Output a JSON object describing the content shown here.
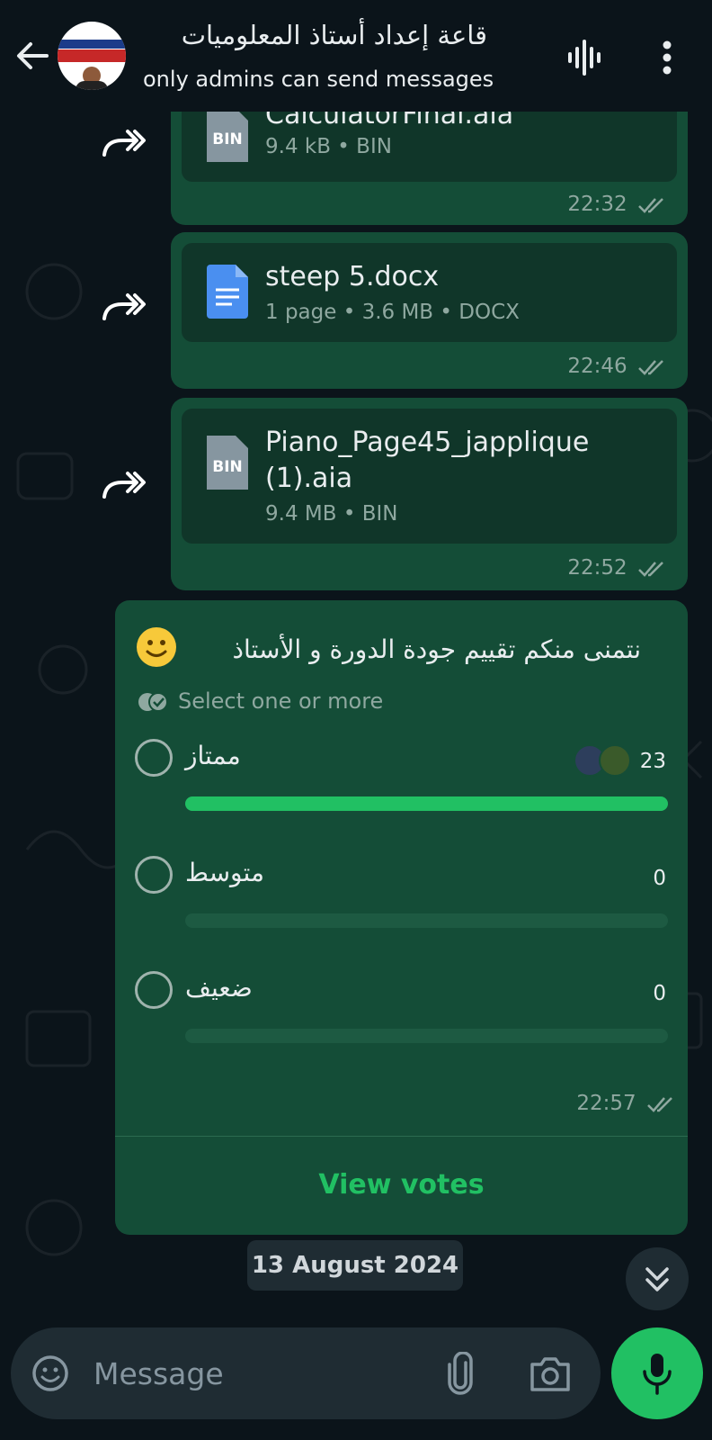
{
  "header": {
    "title": "قاعة إعداد أستاذ المعلوميات",
    "subtitle": "only admins can send messages",
    "back_icon": "arrow-left-icon",
    "voice_icon": "audio-wave-icon",
    "menu_icon": "more-vert-icon"
  },
  "messages": [
    {
      "file_name": "CalculatorFinal.aia",
      "meta": "9.4 kB • BIN",
      "file_type": "BIN",
      "time": "22:32"
    },
    {
      "file_name": "steep 5.docx",
      "meta": "1 page • 3.6 MB • DOCX",
      "file_type": "DOCX",
      "time": "22:46"
    },
    {
      "file_name": "Piano_Page45_japplique (1).aia",
      "meta": "9.4 MB • BIN",
      "file_type": "BIN",
      "time": "22:52"
    }
  ],
  "poll": {
    "question": "نتمنى منكم تقييم جودة الدورة و الأستاذ",
    "hint": "Select one or more",
    "options": [
      {
        "label": "ممتاز",
        "votes": "23",
        "share": 1.0
      },
      {
        "label": "متوسط",
        "votes": "0",
        "share": 0
      },
      {
        "label": "ضعيف",
        "votes": "0",
        "share": 0
      }
    ],
    "time": "22:57",
    "view_votes": "View votes"
  },
  "date_chip": "13 August 2024",
  "composer": {
    "placeholder": "Message"
  },
  "colors": {
    "accent": "#21c063",
    "bubble": "#144d37",
    "background": "#0b141a"
  }
}
